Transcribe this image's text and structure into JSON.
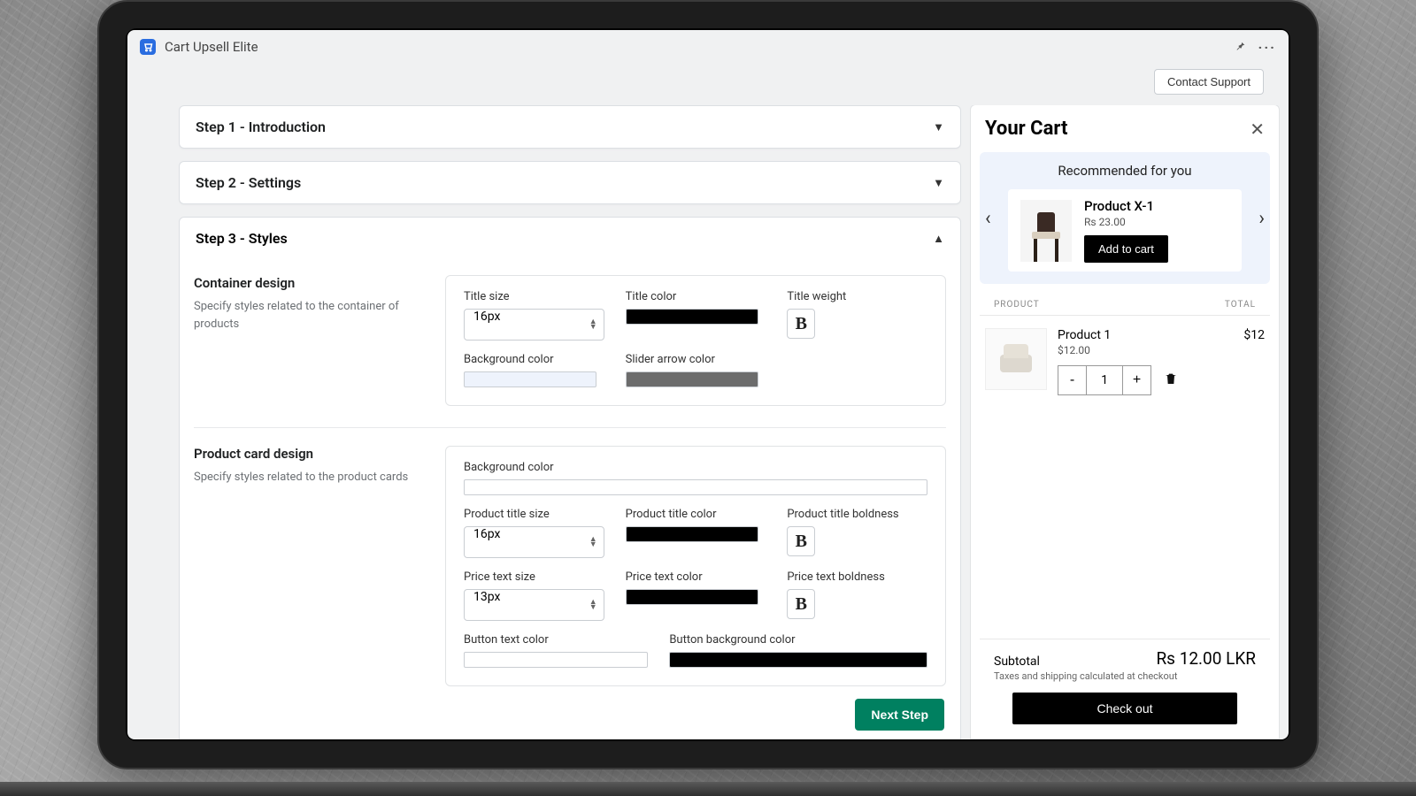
{
  "app": {
    "title": "Cart Upsell Elite"
  },
  "header": {
    "contact_support": "Contact Support"
  },
  "steps": {
    "s1": "Step 1 - Introduction",
    "s2": "Step 2 - Settings",
    "s3": "Step 3 - Styles"
  },
  "container_design": {
    "heading": "Container design",
    "desc": "Specify styles related to the container of products",
    "title_size_label": "Title size",
    "title_size_value": "16px",
    "title_color_label": "Title color",
    "title_color_value": "#000000",
    "title_weight_label": "Title weight",
    "bg_label": "Background color",
    "bg_value": "#eef3fc",
    "arrow_label": "Slider arrow color",
    "arrow_value": "#6c6c6c"
  },
  "product_card": {
    "heading": "Product card design",
    "desc": "Specify styles related to the product cards",
    "bg_label": "Background color",
    "bg_value": "#ffffff",
    "ptitle_size_label": "Product title size",
    "ptitle_size_value": "16px",
    "ptitle_color_label": "Product title color",
    "ptitle_color_value": "#000000",
    "ptitle_bold_label": "Product title boldness",
    "price_size_label": "Price text size",
    "price_size_value": "13px",
    "price_color_label": "Price text color",
    "price_color_value": "#000000",
    "price_bold_label": "Price text boldness",
    "btn_text_color_label": "Button text color",
    "btn_text_color_value": "#ffffff",
    "btn_bg_label": "Button background color",
    "btn_bg_value": "#000000"
  },
  "actions": {
    "next": "Next Step"
  },
  "cart": {
    "title": "Your Cart",
    "rec_title": "Recommended for you",
    "rec_product": "Product X-1",
    "rec_price": "Rs 23.00",
    "add": "Add to cart",
    "col_product": "PRODUCT",
    "col_total": "TOTAL",
    "item_name": "Product 1",
    "item_price": "$12.00",
    "item_qty": "1",
    "item_line_total": "$12",
    "subtotal_label": "Subtotal",
    "subtotal_value": "Rs 12.00 LKR",
    "tax_note": "Taxes and shipping calculated at checkout",
    "checkout": "Check out"
  }
}
